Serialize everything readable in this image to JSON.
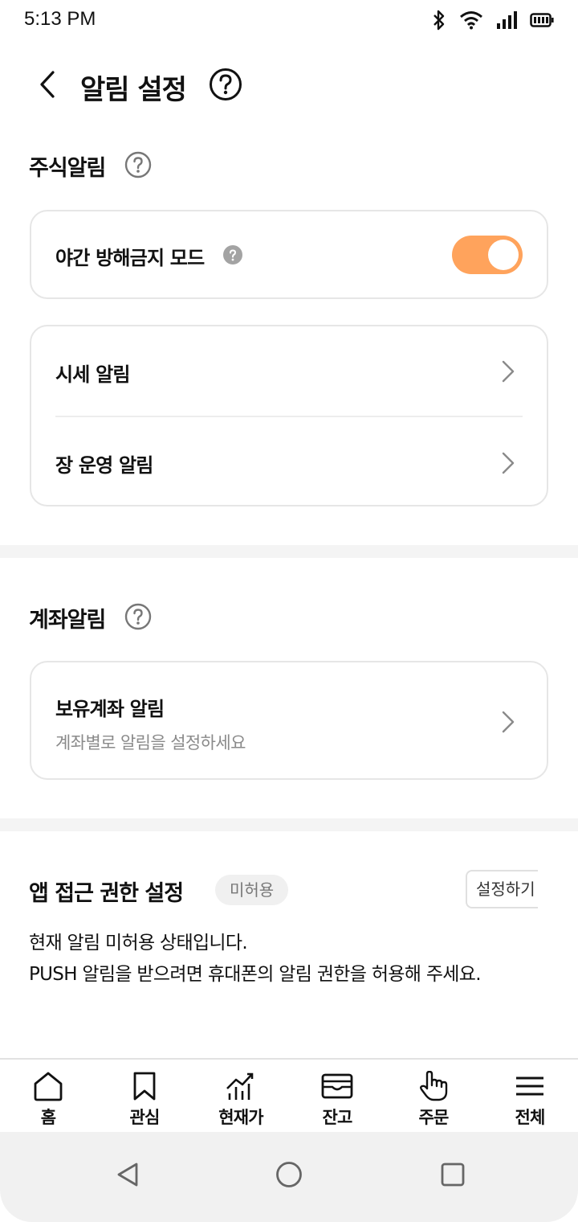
{
  "status_bar": {
    "time": "5:13 PM"
  },
  "header": {
    "title": "알림 설정"
  },
  "stock_alerts": {
    "title": "주식알림",
    "night_mode": {
      "label": "야간 방해금지 모드",
      "enabled": true
    },
    "rows": [
      {
        "label": "시세 알림"
      },
      {
        "label": "장 운영 알림"
      }
    ]
  },
  "account_alerts": {
    "title": "계좌알림",
    "row": {
      "label": "보유계좌 알림",
      "sub": "계좌별로 알림을 설정하세요"
    }
  },
  "app_permission": {
    "title": "앱 접근 권한 설정",
    "badge": "미허용",
    "button": "설정하기",
    "line1": "현재 알림 미허용 상태입니다.",
    "line2": "PUSH 알림을 받으려면 휴대폰의 알림 권한을 허용해 주세요."
  },
  "bottom_nav": {
    "items": [
      {
        "label": "홈",
        "icon": "home-icon"
      },
      {
        "label": "관심",
        "icon": "bookmark-icon"
      },
      {
        "label": "현재가",
        "icon": "chart-icon"
      },
      {
        "label": "잔고",
        "icon": "wallet-icon"
      },
      {
        "label": "주문",
        "icon": "hand-pointer-icon"
      },
      {
        "label": "전체",
        "icon": "menu-icon"
      }
    ]
  },
  "colors": {
    "accent": "#ffa35c",
    "border": "#e6e6e6",
    "band": "#f4f4f4"
  }
}
